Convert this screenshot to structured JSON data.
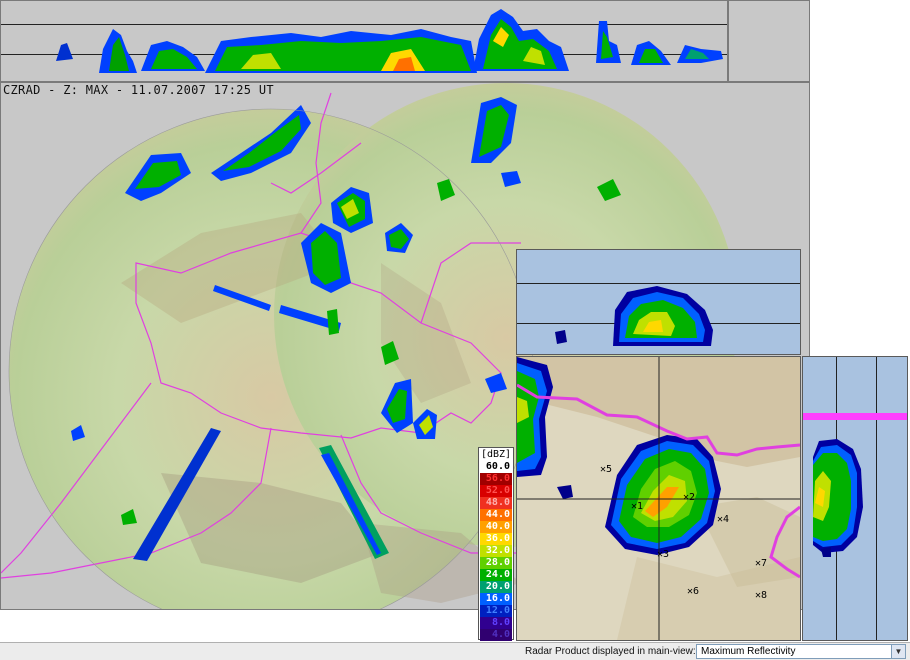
{
  "main": {
    "title": "CZRAD - Z: MAX - 11.07.2007 17:25 UT"
  },
  "legend": {
    "unit": "[dBZ]",
    "levels": [
      {
        "label": "60.0",
        "color": "#ffffff",
        "text_color": "#000000"
      },
      {
        "label": "56.0",
        "color": "#a00000",
        "text_color": "#ff3030"
      },
      {
        "label": "52.0",
        "color": "#d80000",
        "text_color": "#ff5050"
      },
      {
        "label": "48.0",
        "color": "#f03020",
        "text_color": "#ffb0b0"
      },
      {
        "label": "44.0",
        "color": "#ff7000",
        "text_color": "#ffffff"
      },
      {
        "label": "40.0",
        "color": "#ffa000",
        "text_color": "#ffffff"
      },
      {
        "label": "36.0",
        "color": "#ffd800",
        "text_color": "#ffffff"
      },
      {
        "label": "32.0",
        "color": "#c0e000",
        "text_color": "#ffffff"
      },
      {
        "label": "28.0",
        "color": "#60d000",
        "text_color": "#ffffff"
      },
      {
        "label": "24.0",
        "color": "#00b000",
        "text_color": "#ffffff"
      },
      {
        "label": "20.0",
        "color": "#00a070",
        "text_color": "#ffffff"
      },
      {
        "label": "16.0",
        "color": "#0060ff",
        "text_color": "#ffffff"
      },
      {
        "label": "12.0",
        "color": "#0020c0",
        "text_color": "#4080ff"
      },
      {
        "label": "8.0",
        "color": "#300090",
        "text_color": "#6040ff"
      },
      {
        "label": "4.0",
        "color": "#300070",
        "text_color": "#5030c0"
      }
    ]
  },
  "zoom": {
    "markers": [
      "1",
      "2",
      "3",
      "4",
      "5",
      "6",
      "7",
      "8"
    ]
  },
  "status": {
    "label": "Radar Product displayed in main-view:",
    "selected_product": "Maximum Reflectivity"
  }
}
